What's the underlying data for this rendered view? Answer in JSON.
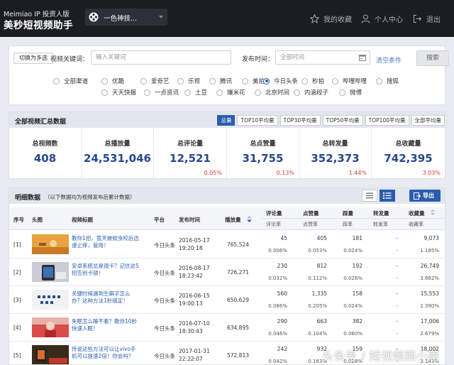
{
  "header": {
    "brand_en": "Meimiao IP 投资人版",
    "brand_cn": "美秒短视频助手",
    "channel_label": "一色神技...",
    "nav": [
      {
        "label": "我的收藏",
        "icon": "star-icon"
      },
      {
        "label": "个人中心",
        "icon": "user-icon"
      },
      {
        "label": "退出",
        "icon": "logout-icon"
      }
    ]
  },
  "filter": {
    "toggle_label": "切换为多选",
    "keyword_label": "视频关键词：",
    "keyword_placeholder": "输入关键词",
    "time_label": "发布时间：",
    "time_placeholder": "全部时间",
    "clear_label": "清空条件",
    "search_label": "搜索",
    "platforms_row1": [
      "全部渠道",
      "优酷",
      "爱奇艺",
      "乐视",
      "腾讯",
      "美拍",
      "今日头条",
      "秒拍",
      "哔哩哔哩",
      "搜狐"
    ],
    "platforms_row2": [
      "天天快报",
      "一点资讯",
      "土豆",
      "爆米花",
      "北京时间",
      "内涵段子",
      "微博"
    ],
    "selected_platform": "今日头条"
  },
  "summary": {
    "title": "全部视频汇总数据",
    "tabs": [
      "总量",
      "TOP10平均量",
      "TOP30平均量",
      "TOP50平均量",
      "TOP100平均量",
      "全部平均量"
    ],
    "active_tab": "总量",
    "stats": [
      {
        "label": "总视频数",
        "value": "408",
        "change": ""
      },
      {
        "label": "总播放量",
        "value": "24,531,046",
        "change": ""
      },
      {
        "label": "总评论量",
        "value": "12,521",
        "change": "0.05%"
      },
      {
        "label": "总点赞量",
        "value": "31,755",
        "change": "0.13%"
      },
      {
        "label": "总转发量",
        "value": "352,373",
        "change": "1.44%"
      },
      {
        "label": "总收藏量",
        "value": "742,395",
        "change": "3.03%"
      }
    ]
  },
  "detail": {
    "title": "明细数据",
    "subtitle": "（以下数据均为视频发布后累计数据）",
    "export_label": "导出",
    "columns": {
      "index": "序号",
      "thumb": "头图",
      "title": "视频标题",
      "platform": "平台",
      "time": "发布时间",
      "plays": "播放量",
      "comments": "评论量",
      "comment_rate": "评论率",
      "likes": "点赞量",
      "like_rate": "点赞率",
      "dislikes": "踩量",
      "dislike_rate": "踩率",
      "shares": "转发量",
      "share_rate": "转发率",
      "favorites": "收藏量",
      "favorite_rate": "收藏率"
    },
    "rows": [
      {
        "index": "[1]",
        "title": "教你1招，宽天被蚊虫咬后迅速止痒，管用！",
        "platform": "今日头条",
        "date": "2016-05-17",
        "clock": "19:20:18",
        "plays": "765,524",
        "comments": "45",
        "comment_rate": "0.006%",
        "likes": "405",
        "like_rate": "0.053%",
        "dislikes": "181",
        "dislike_rate": "0.024%",
        "shares": "-",
        "share_rate": "-",
        "favorites": "9,073",
        "favorite_rate": "1.185%"
      },
      {
        "index": "[2]",
        "title": "安卓系统总是很卡？记住这5招告别卡顿！",
        "platform": "今日头条",
        "date": "2016-08-17",
        "clock": "18:23:42",
        "plays": "726,271",
        "comments": "230",
        "comment_rate": "0.032%",
        "likes": "812",
        "like_rate": "0.112%",
        "dislikes": "192",
        "dislike_rate": "0.026%",
        "shares": "-",
        "share_rate": "-",
        "favorites": "26,749",
        "favorite_rate": "3.682%"
      },
      {
        "index": "[3]",
        "title": "关键时候遇到生僻字怎么办？这种方法1秒搞定！",
        "platform": "今日头条",
        "date": "2016-06-15",
        "clock": "19:00:13",
        "plays": "650,629",
        "comments": "560",
        "comment_rate": "0.086%",
        "likes": "1,335",
        "like_rate": "0.205%",
        "dislikes": "158",
        "dislike_rate": "0.024%",
        "shares": "-",
        "share_rate": "-",
        "favorites": "15,553",
        "favorite_rate": "2.390%"
      },
      {
        "index": "[4]",
        "title": "失眠怎么睡不着？教你10秒快速入眠！",
        "platform": "今日头条",
        "date": "2016-07-10",
        "clock": "18:30:43",
        "plays": "634,895",
        "comments": "290",
        "comment_rate": "0.046%",
        "likes": "663",
        "like_rate": "0.104%",
        "dislikes": "382",
        "dislike_rate": "0.060%",
        "shares": "-",
        "share_rate": "-",
        "favorites": "17,006",
        "favorite_rate": "2.679%"
      },
      {
        "index": "[5]",
        "title": "传说这些方法可以让vivo手机可以提速2倍！你会吗？",
        "platform": "今日头条",
        "date": "2017-01-31",
        "clock": "22:22:07",
        "plays": "572,813",
        "comments": "242",
        "comment_rate": "0.042%",
        "likes": "932",
        "like_rate": "0.163%",
        "dislikes": "159",
        "dislike_rate": "0.028%",
        "shares": "-",
        "share_rate": "-",
        "favorites": "18,002",
        "favorite_rate": "3.143%"
      }
    ]
  },
  "watermark": "头条号 / 短视频顾小雨"
}
